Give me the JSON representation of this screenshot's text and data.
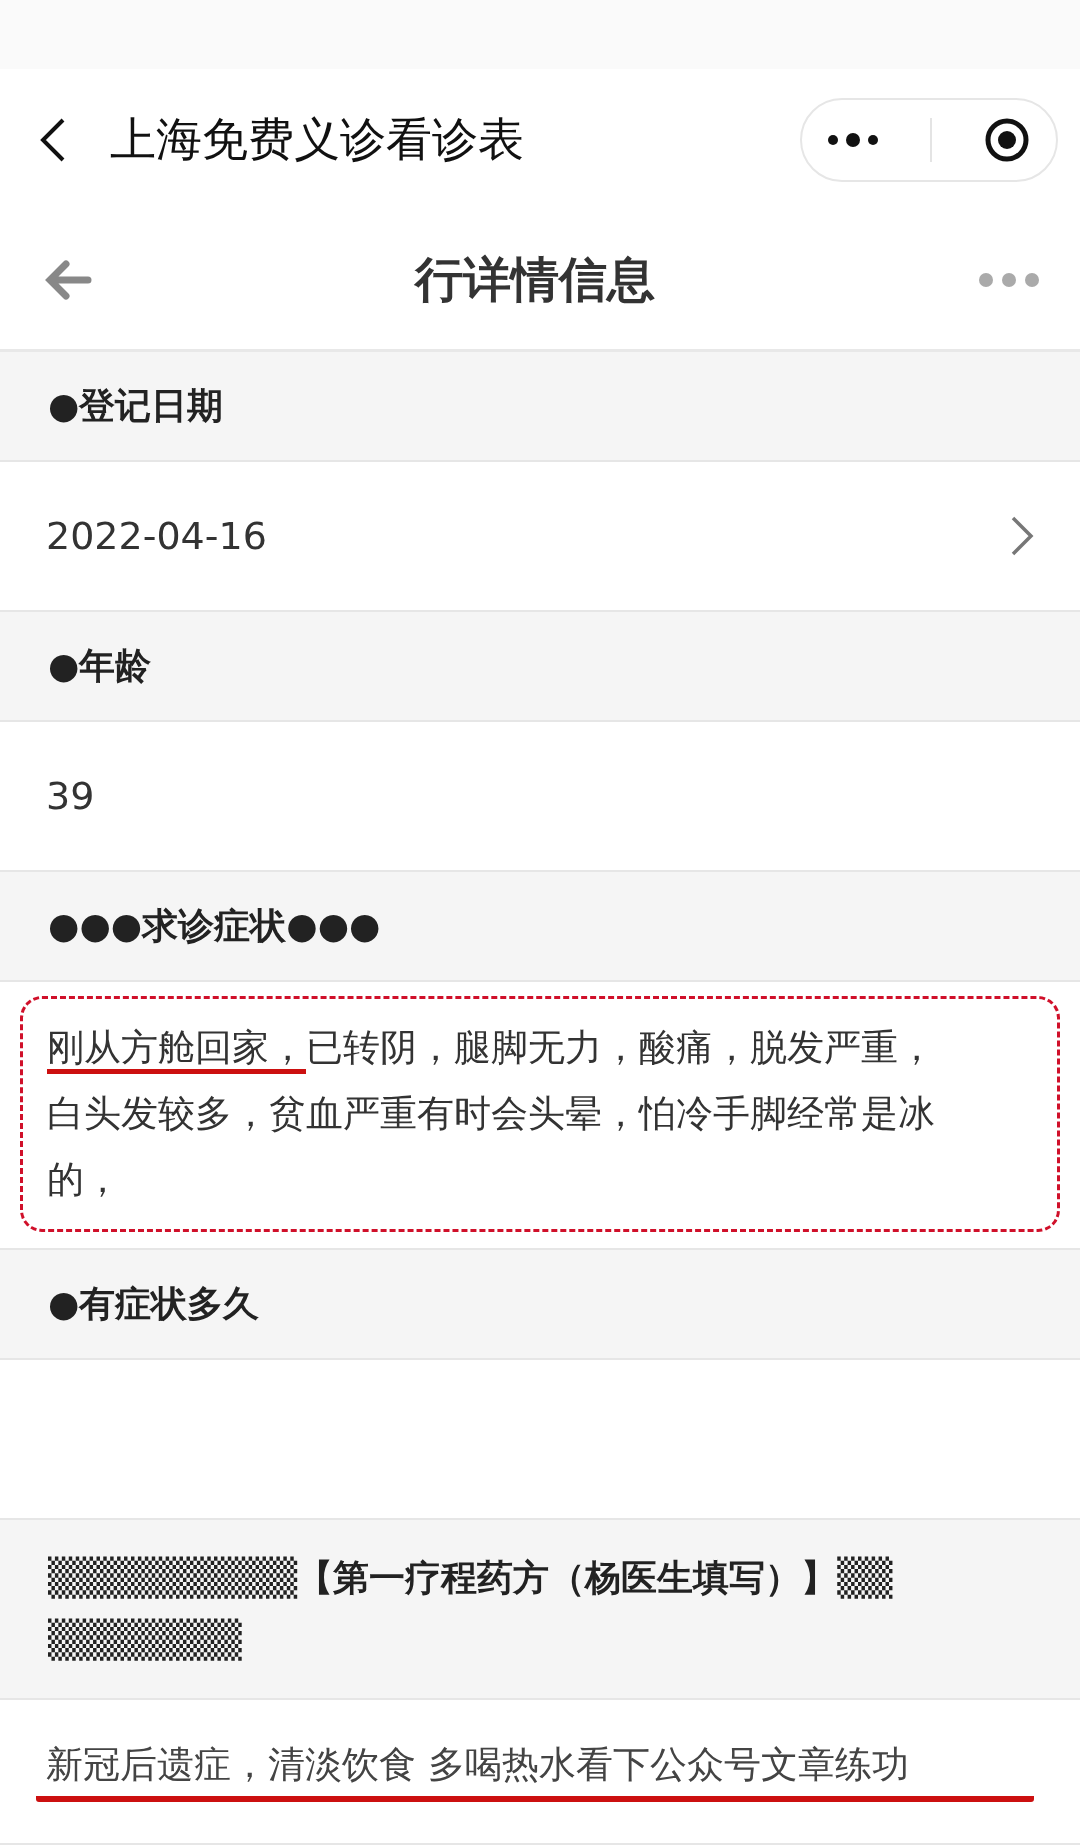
{
  "app_bar": {
    "title": "上海免费义诊看诊表"
  },
  "header": {
    "title": "行详情信息"
  },
  "sections": [
    {
      "label": "●登记日期",
      "kind": "picker",
      "value": "2022-04-16"
    },
    {
      "label": "●年龄",
      "kind": "text",
      "value": "39"
    },
    {
      "label": "●●●求诊症状●●●",
      "kind": "boxed",
      "highlight": "刚从方舱回家，",
      "value": "已转阴，腿脚无力，酸痛，脱发严重，白头发较多，贫血严重有时会头晕，怕冷手脚经常是冰的，"
    },
    {
      "label": "●有症状多久",
      "kind": "empty"
    },
    {
      "label": "▒▒▒▒▒▒▒▒▒【第一疗程药方（杨医生填写）】▒▒▒▒▒▒▒▒▒",
      "kind": "underlined",
      "value": "新冠后遗症，清淡饮食 多喝热水看下公众号文章练功"
    }
  ]
}
